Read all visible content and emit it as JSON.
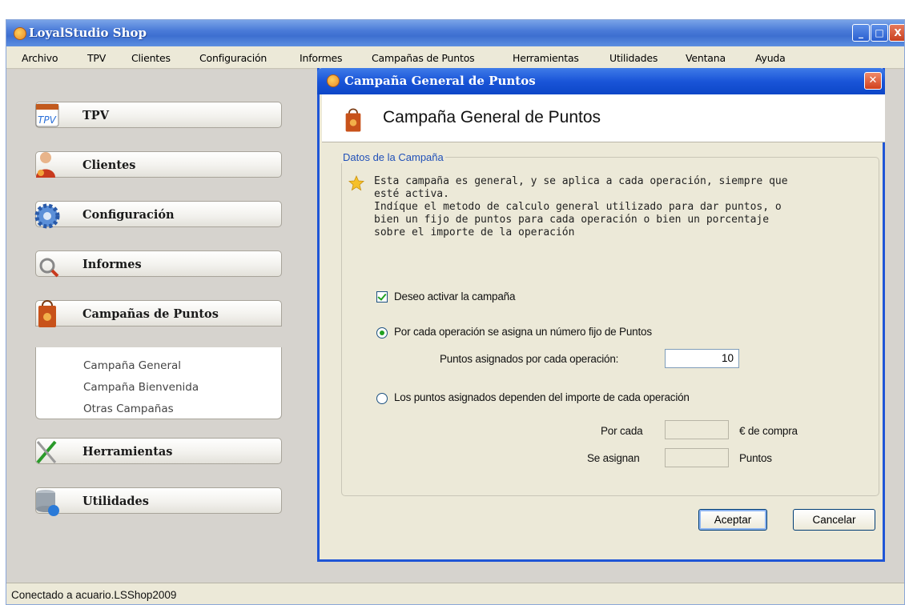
{
  "app": {
    "title": "LoyalStudio Shop"
  },
  "window_controls": {
    "minimize": "_",
    "maximize": "□",
    "close": "X"
  },
  "menu": [
    "Archivo",
    "TPV",
    "Clientes",
    "Configuración",
    "Informes",
    "Campañas de Puntos",
    "Herramientas",
    "Utilidades",
    "Ventana",
    "Ayuda"
  ],
  "sidebar": {
    "items": [
      {
        "label": "TPV",
        "icon": "tpv-icon"
      },
      {
        "label": "Clientes",
        "icon": "user-icon"
      },
      {
        "label": "Configuración",
        "icon": "gear-icon"
      },
      {
        "label": "Informes",
        "icon": "magnifier-icon"
      },
      {
        "label": "Campañas de Puntos",
        "icon": "shopping-bag-icon"
      },
      {
        "label": "Herramientas",
        "icon": "tools-icon"
      },
      {
        "label": "Utilidades",
        "icon": "database-icon"
      }
    ],
    "submenu": [
      "Campaña General",
      "Campaña Bienvenida",
      "Otras Campañas"
    ]
  },
  "dialog": {
    "title": "Campaña General de Puntos",
    "header": "Campaña General de Puntos",
    "group_label": "Datos de la Campaña",
    "description": "Esta campaña es general, y se aplica a cada operación, siempre que\nesté activa.\nIndíque el metodo de calculo general utilizado para dar puntos, o\nbien un fijo de puntos para cada operación o bien un porcentaje\nsobre el importe de la operación",
    "activate_label": "Deseo activar la campaña",
    "activate_checked": true,
    "option_fixed_label": "Por cada operación se asigna un número fijo de Puntos",
    "option_fixed_selected": true,
    "points_per_op_label": "Puntos asignados por cada operación:",
    "points_per_op_value": "10",
    "option_amount_label": "Los puntos asignados dependen del importe de cada operación",
    "option_amount_selected": false,
    "por_cada_label": "Por cada",
    "por_cada_value": "",
    "por_cada_unit": "€ de compra",
    "se_asignan_label": "Se asignan",
    "se_asignan_value": "",
    "se_asignan_unit": "Puntos",
    "accept_label": "Aceptar",
    "cancel_label": "Cancelar"
  },
  "status": {
    "text": "Conectado a acuario.LSShop2009"
  },
  "colors": {
    "titlebar": "#3d6fd0",
    "dialog_border": "#1f55d6",
    "group_legend": "#2050b8"
  }
}
